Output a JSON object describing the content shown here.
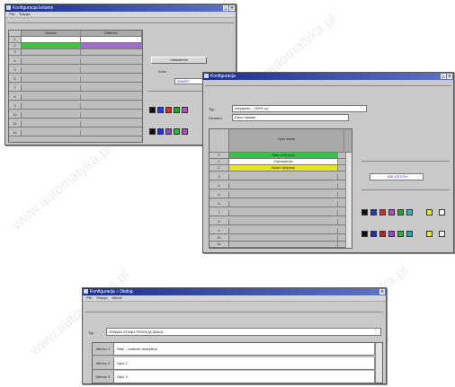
{
  "watermark": "www.automatyka.pl",
  "window_a": {
    "title": "Konfiguracja kolumn",
    "menu": [
      "Plik",
      "Edycja"
    ],
    "col_headers": [
      "Nazwa",
      "Wartość"
    ],
    "row_labels": [
      "1",
      "2",
      "3",
      "4",
      "5",
      "6",
      "7",
      "8",
      "9",
      "10",
      "11",
      "12"
    ],
    "row_fill_colors": [
      [
        "#ffffff",
        "#ffffff"
      ],
      [
        "#42c442",
        "#a16bc9"
      ]
    ],
    "panel_option_a": "Ustawienia",
    "panel_option_b": "Kolor",
    "panel_value": "0000FF",
    "swatches_row1": [
      "#111111",
      "#2b3bd1",
      "#e02a2a",
      "#2fa02f",
      "#c04cc4"
    ],
    "swatches_row2": [
      "#111111",
      "#2033c8",
      "#9944cc",
      "#39b04a",
      "#b04fc0"
    ]
  },
  "window_b": {
    "title": "Konfiguracja",
    "field_label_1": "Typ",
    "field_value_1": "Wskaźnik – 100% (x)",
    "field_label_2": "Element",
    "field_value_2": "Dane lokalne",
    "grid_header": "Opis stanu",
    "row_labels": [
      "0",
      "1",
      "2",
      "3",
      "4",
      "5",
      "6",
      "7",
      "8",
      "9",
      "10",
      "11"
    ],
    "row_values": [
      "Stan normalny",
      "Ostrzeżenie",
      "Alarm aktywny",
      "",
      "",
      "",
      "",
      "",
      "",
      "",
      "",
      ""
    ],
    "row_colors": [
      "#33c24a",
      "#ffffff",
      "#e6e22a",
      "#bdbdbd",
      "#bdbdbd",
      "#bdbdbd",
      "#bdbdbd",
      "#bdbdbd",
      "#bdbdbd",
      "#bdbdbd",
      "#bdbdbd",
      "#bdbdbd"
    ],
    "side_value": "ABCDEFGH",
    "swatches_row1": [
      "#111111",
      "#1f35c8",
      "#e02828",
      "#b04fc0",
      "#27a83d",
      "#2ab5c8",
      "#e8e22a",
      "#ffffff"
    ],
    "swatches_row2": [
      "#111111",
      "#1e30c2",
      "#c81e1e",
      "#9d44c9",
      "#30b044",
      "#23a6b4",
      "#e6e62c",
      "#f2f2f2"
    ]
  },
  "window_c": {
    "title": "Konfiguracja – Dialog",
    "menu": [
      "Plik",
      "Edycja",
      "Widok"
    ],
    "field_label": "Typ",
    "field_value": "ZMIANA STANU PRZEŁĄCZNIKA",
    "rows": [
      {
        "label": "Wiersz 1",
        "value": "Stan – wartość domyślna"
      },
      {
        "label": "Wiersz 2",
        "value": "Opis 2"
      },
      {
        "label": "Wiersz 3",
        "value": "Opis 3"
      }
    ]
  }
}
